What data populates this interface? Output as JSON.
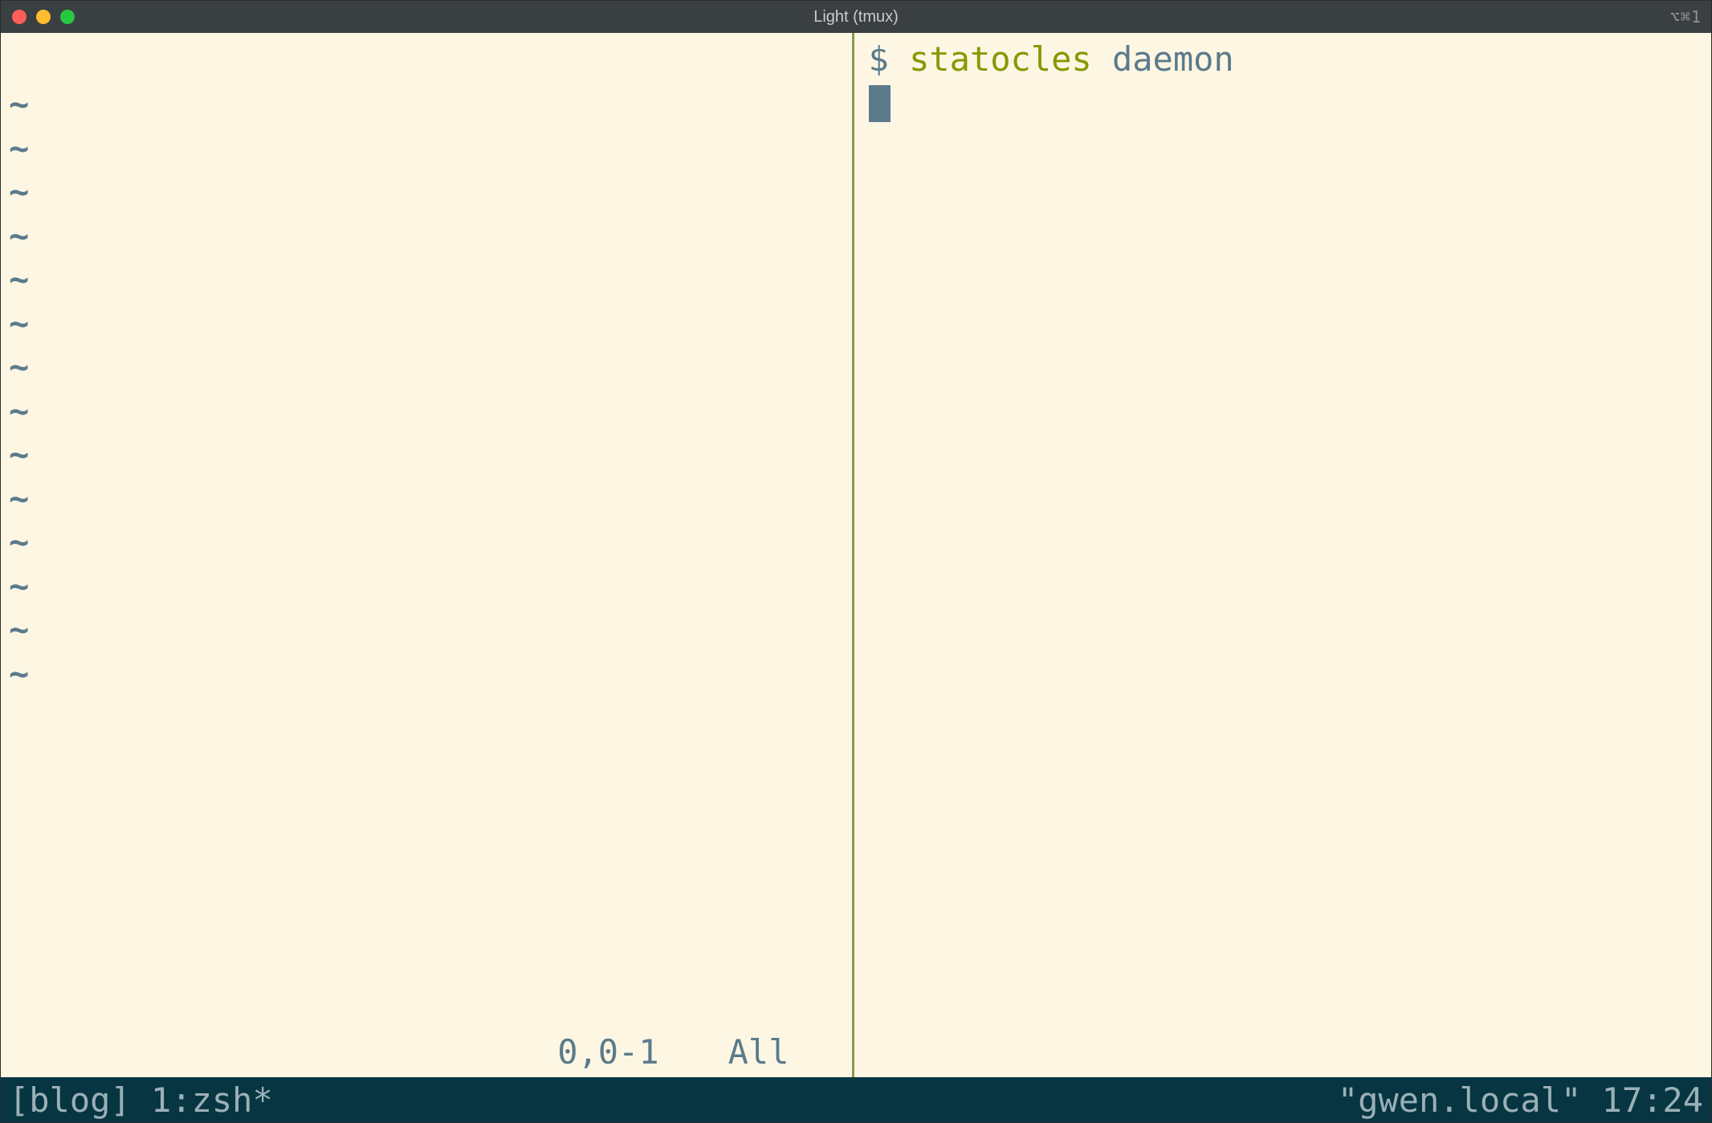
{
  "titlebar": {
    "title": "Light (tmux)",
    "right_indicator": "⌥⌘1"
  },
  "vim": {
    "tilde": "~",
    "tilde_count": 14,
    "status_pos": "0,0-1",
    "status_pct": "All"
  },
  "shell": {
    "prompt": "$",
    "command": "statocles",
    "argument": "daemon"
  },
  "tmux": {
    "session": "[blog]",
    "window": "1:zsh*",
    "host": "\"gwen.local\"",
    "time": "17:24"
  }
}
